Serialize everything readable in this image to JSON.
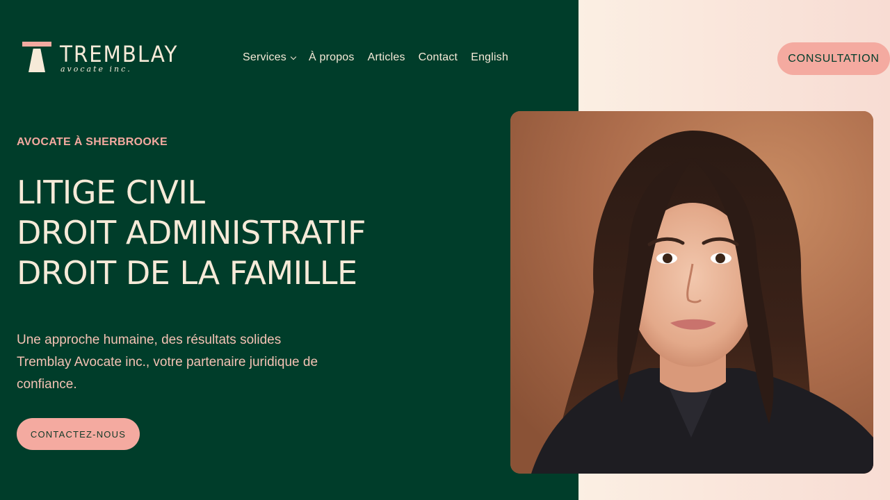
{
  "brand": {
    "name": "TREMBLAY",
    "subtitle": "avocate inc."
  },
  "nav": {
    "items": [
      {
        "label": "Services"
      },
      {
        "label": "À propos"
      },
      {
        "label": "Articles"
      },
      {
        "label": "Contact"
      },
      {
        "label": "English"
      }
    ]
  },
  "header": {
    "cta_label": "CONSULTATION"
  },
  "hero": {
    "eyebrow": "AVOCATE À SHERBROOKE",
    "headline_lines": [
      "LITIGE CIVIL",
      "DROIT ADMINISTRATIF",
      "DROIT DE LA FAMILLE"
    ],
    "intro_line1": "Une approche humaine, des résultats solides",
    "intro_line2": "Tremblay Avocate inc., votre partenaire juridique de confiance.",
    "cta_label": "CONTACTEZ-NOUS"
  },
  "colors": {
    "dark_green": "#003d2a",
    "pink_accent": "#f4aaa0",
    "cream": "#f6ead8"
  }
}
